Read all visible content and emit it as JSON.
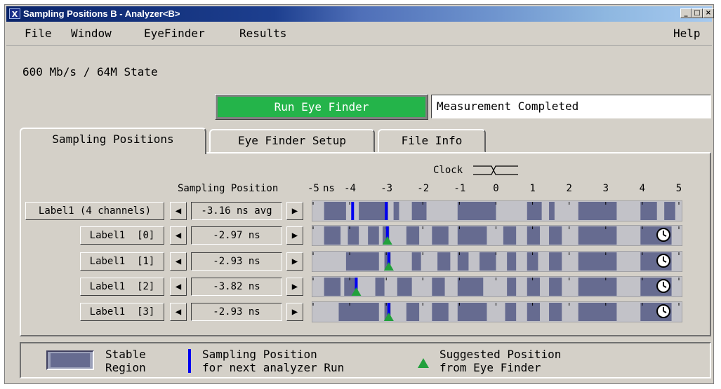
{
  "window": {
    "title": "Sampling Positions B - Analyzer<B>",
    "app_icon_glyph": "X",
    "controls": {
      "minimize": "_",
      "maximize": "□",
      "close": "×"
    }
  },
  "menu": {
    "file": "File",
    "window": "Window",
    "eyefinder": "EyeFinder",
    "results": "Results",
    "help": "Help"
  },
  "rate_label": "600 Mb/s / 64M State",
  "run_button_label": "Run Eye Finder",
  "status_text": "Measurement Completed",
  "tabs": [
    {
      "label": "Sampling Positions",
      "active": true
    },
    {
      "label": "Eye Finder Setup",
      "active": false
    },
    {
      "label": "File Info",
      "active": false
    }
  ],
  "clock_label": "Clock",
  "sampling_position_label": "Sampling Position",
  "axis": {
    "unit_label": "ns",
    "min": -5,
    "max": 5,
    "ticks": [
      "-5",
      "-4",
      "-3",
      "-2",
      "-1",
      "0",
      "1",
      "2",
      "3",
      "4",
      "5"
    ]
  },
  "rows": [
    {
      "label": "Label1 (4 channels)",
      "value": "-3.16 ns avg",
      "is_group": true,
      "has_clock_icon": false,
      "sampling_position": [
        -3.92,
        -3.0
      ],
      "suggested_position": null,
      "stable_regions": [
        [
          -4.7,
          -4.1
        ],
        [
          -3.75,
          -2.95
        ],
        [
          -2.8,
          -2.65
        ],
        [
          -2.3,
          -1.9
        ],
        [
          -1.05,
          0.0
        ],
        [
          0.85,
          1.25
        ],
        [
          1.45,
          1.6
        ],
        [
          2.25,
          3.3
        ],
        [
          3.95,
          4.4
        ],
        [
          4.6,
          4.9
        ]
      ]
    },
    {
      "label": "Label1  [0]",
      "value": "-2.97 ns",
      "is_group": false,
      "has_clock_icon": true,
      "sampling_position": [
        -2.97
      ],
      "suggested_position": -2.97,
      "stable_regions": [
        [
          -4.7,
          -4.25
        ],
        [
          -4.05,
          -3.75
        ],
        [
          -3.5,
          -3.2
        ],
        [
          -3.1,
          -2.92
        ],
        [
          -2.45,
          -2.1
        ],
        [
          -1.75,
          -1.3
        ],
        [
          -1.05,
          -0.25
        ],
        [
          0.2,
          0.55
        ],
        [
          0.85,
          1.2
        ],
        [
          1.45,
          1.8
        ],
        [
          2.25,
          3.3
        ],
        [
          3.95,
          4.8
        ]
      ]
    },
    {
      "label": "Label1  [1]",
      "value": "-2.93 ns",
      "is_group": false,
      "has_clock_icon": true,
      "sampling_position": [
        -2.93
      ],
      "suggested_position": -2.93,
      "stable_regions": [
        [
          -4.1,
          -3.2
        ],
        [
          -3.05,
          -2.88
        ],
        [
          -2.3,
          -2.05
        ],
        [
          -1.6,
          -1.25
        ],
        [
          -1.05,
          -0.75
        ],
        [
          -0.45,
          0.0
        ],
        [
          0.3,
          0.55
        ],
        [
          0.85,
          1.15
        ],
        [
          1.45,
          1.8
        ],
        [
          2.25,
          3.3
        ],
        [
          3.95,
          4.8
        ]
      ]
    },
    {
      "label": "Label1  [2]",
      "value": "-3.82 ns",
      "is_group": false,
      "has_clock_icon": true,
      "sampling_position": [
        -3.82
      ],
      "suggested_position": -3.82,
      "stable_regions": [
        [
          -4.7,
          -4.25
        ],
        [
          -4.15,
          -3.82
        ],
        [
          -3.3,
          -3.05
        ],
        [
          -2.7,
          -2.3
        ],
        [
          -1.75,
          -1.4
        ],
        [
          -1.05,
          -0.35
        ],
        [
          0.3,
          0.55
        ],
        [
          0.85,
          1.2
        ],
        [
          1.45,
          1.8
        ],
        [
          2.25,
          3.3
        ],
        [
          3.95,
          4.8
        ]
      ]
    },
    {
      "label": "Label1  [3]",
      "value": "-2.93 ns",
      "is_group": false,
      "has_clock_icon": true,
      "sampling_position": [
        -2.93
      ],
      "suggested_position": -2.93,
      "stable_regions": [
        [
          -4.3,
          -3.2
        ],
        [
          -3.05,
          -2.88
        ],
        [
          -2.45,
          -2.1
        ],
        [
          -1.75,
          -1.3
        ],
        [
          -1.05,
          -0.25
        ],
        [
          0.25,
          0.55
        ],
        [
          0.85,
          1.2
        ],
        [
          1.45,
          1.8
        ],
        [
          2.25,
          3.3
        ],
        [
          3.95,
          4.8
        ]
      ]
    }
  ],
  "legend": {
    "stable_region_line1": "Stable",
    "stable_region_line2": "Region",
    "sampling_line1": "Sampling Position",
    "sampling_line2": "for next analyzer Run",
    "suggested_line1": "Suggested Position",
    "suggested_line2": "from Eye Finder"
  },
  "colors": {
    "stable_region": "#666b90",
    "unstable_region": "#c2c2c8",
    "sampling_marker": "#0000f0",
    "suggested_marker": "#22a03c",
    "run_button": "#24b44a"
  },
  "icons": {
    "left_arrow": "◀",
    "right_arrow": "▶",
    "clock": "🕓"
  }
}
